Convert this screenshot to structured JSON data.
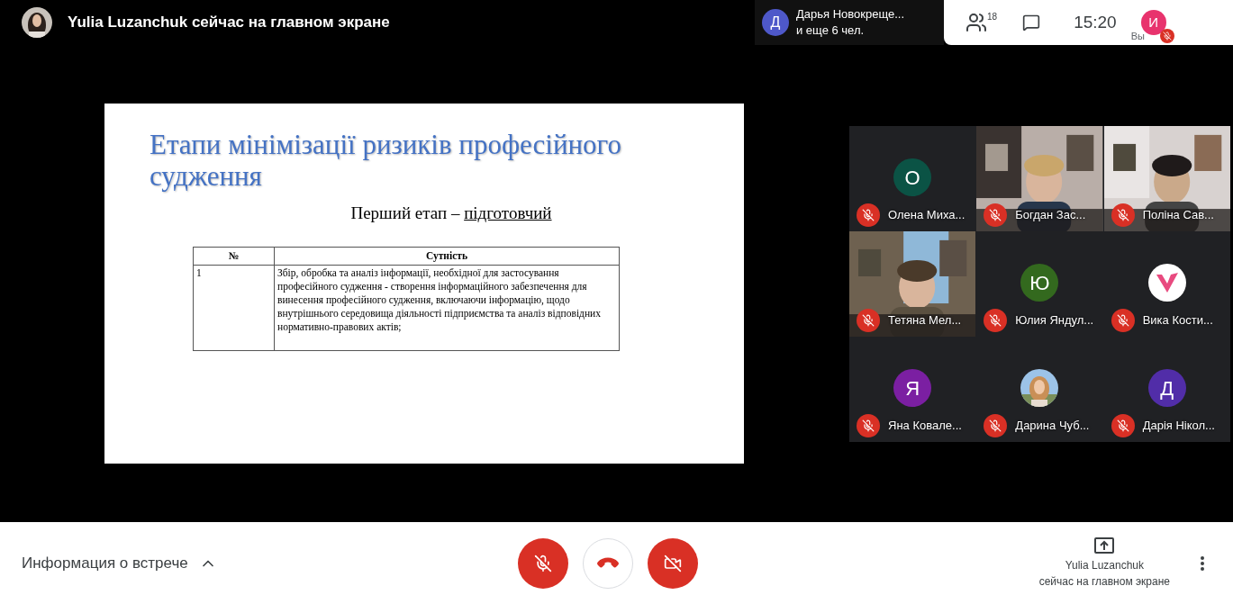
{
  "top_bar": {
    "presenter_title": "Yulia Luzanchuk сейчас на главном экране",
    "participants_chip": {
      "initial": "Д",
      "color": "#4e58c9",
      "line_1": "Дарья Новокреще...",
      "line_2": "и еще 6 чел."
    },
    "people_count": "18",
    "time": "15:20",
    "self": {
      "initial": "И",
      "color": "#e8336d",
      "label": "Вы",
      "muted": true
    }
  },
  "slide": {
    "title": "Етапи мінімізації ризиків професійного судження",
    "subtitle": {
      "text": "Перший етап –",
      "emphasis": "підготовчий"
    },
    "table": {
      "columns": [
        "№",
        "Сутність"
      ],
      "rows": [
        [
          "1",
          "Збір, обробка та аналіз інформації, необхідної для застосування професійного судження - створення інформаційного забезпечення для винесення професійного судження, включаючи інформацію, щодо внутрішнього середовища діяльності підприємства та аналіз відповідних нормативно-правових актів;"
        ]
      ]
    }
  },
  "tiles": [
    {
      "kind": "letter",
      "initial": "О",
      "color": "#0b5345",
      "name": "Олена Миха...",
      "muted": true
    },
    {
      "kind": "video",
      "name": "Богдан Зас...",
      "muted": true
    },
    {
      "kind": "video",
      "name": "Поліна Сав...",
      "muted": true
    },
    {
      "kind": "video",
      "name": "Тетяна Мел...",
      "muted": true
    },
    {
      "kind": "letter",
      "initial": "Ю",
      "color": "#33691e",
      "name": "Юлия Яндул...",
      "muted": true
    },
    {
      "kind": "logo",
      "name": "Вика Кости...",
      "muted": true
    },
    {
      "kind": "letter",
      "initial": "Я",
      "color": "#7b1fa2",
      "name": "Яна Ковале...",
      "muted": true
    },
    {
      "name": "Дарина Чуб...",
      "muted": true
    },
    {
      "kind": "letter",
      "initial": "Д",
      "color": "#512da8",
      "name": "Дарія Нікол...",
      "muted": true
    }
  ],
  "bottom_bar": {
    "meeting_info": "Информация о встрече",
    "controls": [
      {
        "kind": "mic",
        "off": true
      },
      {
        "kind": "hangup"
      },
      {
        "kind": "camera",
        "off": true
      }
    ],
    "presenter_name": "Yulia Luzanchuk",
    "presenter_status": "сейчас на главном экране"
  }
}
